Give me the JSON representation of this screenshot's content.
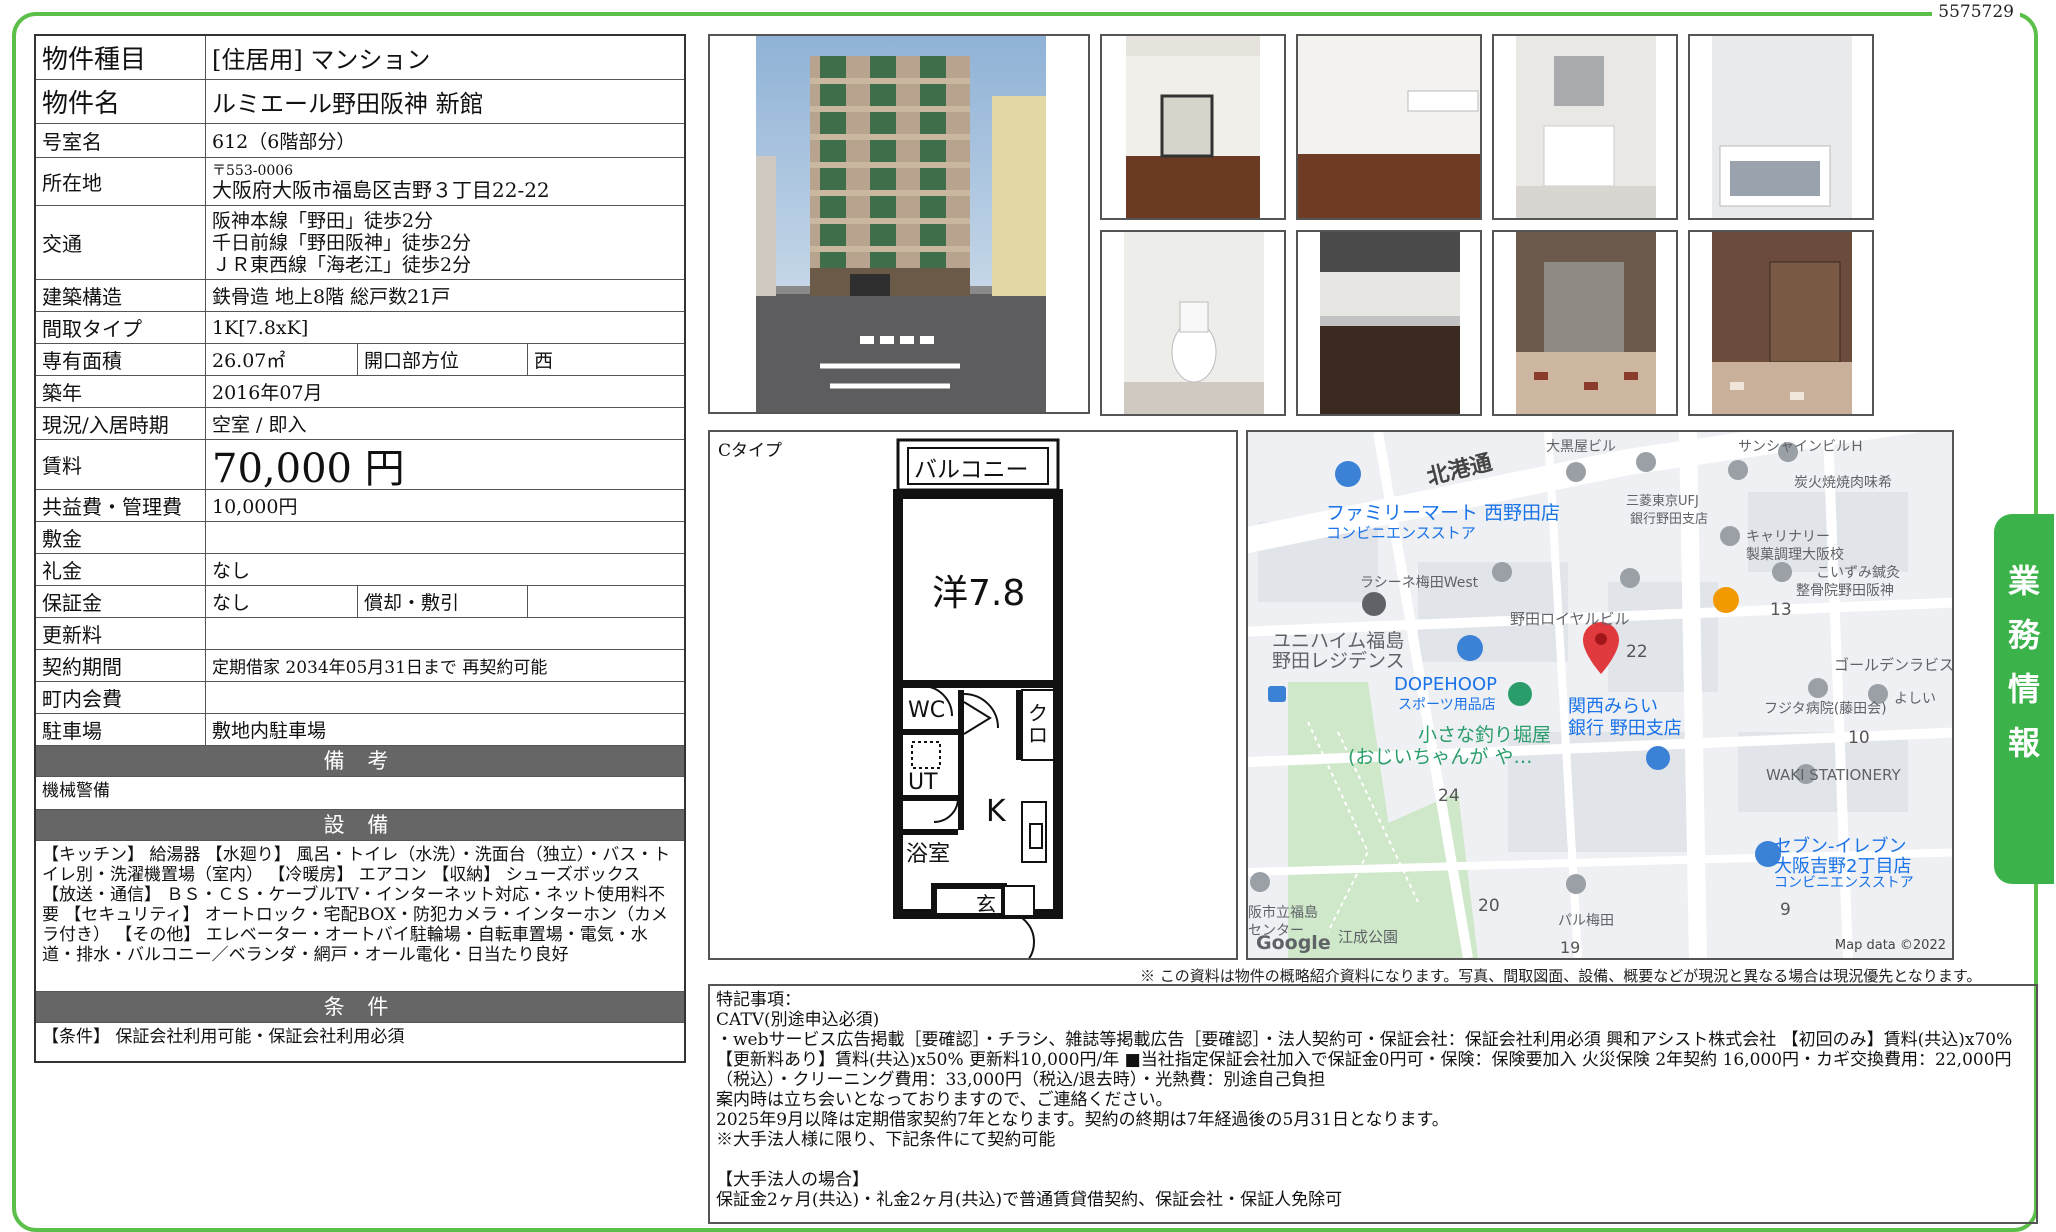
{
  "doc_id": "5575729",
  "info": {
    "type_label": "物件種目",
    "type_value": "[住居用] マンション",
    "name_label": "物件名",
    "name_value": "ルミエール野田阪神 新館",
    "room_label": "号室名",
    "room_value": "612（6階部分）",
    "addr_label": "所在地",
    "addr_zip": "〒553-0006",
    "addr_value": "大阪府大阪市福島区吉野３丁目22-22",
    "access_label": "交通",
    "access": [
      "阪神本線「野田」徒歩2分",
      "千日前線「野田阪神」徒歩2分",
      "ＪＲ東西線「海老江」徒歩2分"
    ],
    "struct_label": "建築構造",
    "struct_value": "鉄骨造 地上8階 総戸数21戸",
    "layout_label": "間取タイプ",
    "layout_value": "1K[7.8xK]",
    "area_label": "専有面積",
    "area_value": "26.07㎡",
    "direction_label": "開口部方位",
    "direction_value": "西",
    "built_label": "築年",
    "built_value": "2016年07月",
    "status_label": "現況/入居時期",
    "status_value": "空室 / 即入",
    "rent_label": "賃料",
    "rent_value": "70,000 円",
    "fee_label": "共益費・管理費",
    "fee_value": "10,000円",
    "deposit_label": "敷金",
    "deposit_value": "",
    "key_label": "礼金",
    "key_value": "なし",
    "guarantee_label": "保証金",
    "guarantee_value": "なし",
    "amort_label": "償却・敷引",
    "amort_value": "",
    "renew_label": "更新料",
    "renew_value": "",
    "contract_label": "契約期間",
    "contract_value": "定期借家 2034年05月31日まで 再契約可能",
    "town_label": "町内会費",
    "town_value": "",
    "parking_label": "駐車場",
    "parking_value": "敷地内駐車場"
  },
  "remarks": {
    "title": "備 考",
    "text": "機械警備"
  },
  "equipment": {
    "title": "設 備",
    "text": "【キッチン】 給湯器 【水廻り】 風呂・トイレ（水洗）・洗面台（独立）・バス・トイレ別・洗濯機置場（室内） 【冷暖房】 エアコン 【収納】 シューズボックス 【放送・通信】 ＢＳ・ＣＳ・ケーブルTV・インターネット対応・ネット使用料不要 【セキュリティ】 オートロック・宅配BOX・防犯カメラ・インターホン（カメラ付き） 【その他】 エレベーター・オートバイ駐輪場・自転車置場・電気・水道・排水・バルコニー／ベランダ・網戸・オール電化・日当たり良好"
  },
  "conditions": {
    "title": "条 件",
    "text": "【条件】 保証会社利用可能・保証会社利用必須"
  },
  "floorplan": {
    "type_label": "Cタイプ",
    "balcony": "バルコニー",
    "western_room": "洋7.8",
    "wc": "WC",
    "closet": "クロ",
    "ut": "UT",
    "kitchen": "K",
    "bath": "浴室",
    "entrance": "玄"
  },
  "map": {
    "streets": [
      "北港通"
    ],
    "places": [
      "ファミリーマート 西野田店",
      "コンビニエンスストア",
      "ラシーネ梅田West",
      "ユニハイム福島",
      "野田レジデンス",
      "DOPEHOOP",
      "スポーツ用品店",
      "小さな釣り堀屋",
      "(おじいちゃんが や…",
      "野田ロイヤルビル",
      "関西みらい",
      "銀行 野田支店",
      "大黒屋ビル",
      "三菱東京UFJ",
      "銀行野田支店",
      "サンシャインビルＨ",
      "炭火焼焼肉味希",
      "キャリナリー",
      "製菓調理大阪校",
      "こいずみ鍼灸",
      "整骨院野田阪神",
      "ゴールデンラビス",
      "フジタ病院(藤田会)",
      "よしい",
      "WAKI STATIONERY",
      "セブン-イレブン",
      "大阪吉野2丁目店",
      "コンビニエンスストア",
      "阪市立福島",
      "センター",
      "江成公園",
      "パル梅田"
    ],
    "numbers": [
      "22",
      "13",
      "10",
      "24",
      "20",
      "9",
      "19"
    ],
    "google": "Google",
    "credit": "Map data ©2022",
    "colors": {
      "pin": "#e03a3e",
      "roads": "#ffffff",
      "park": "#cfe8c9",
      "poi_blue": "#3b82d6",
      "poi_text": "#1a73e8"
    }
  },
  "disclaimer": "※ この資料は物件の概略紹介資料になります。写真、間取図面、設備、概要などが現況と異なる場合は現況優先となります。",
  "notes": {
    "lines": [
      "特記事項：",
      "CATV(別途申込必須)",
      "・webサービス広告掲載［要確認］・チラシ、雑誌等掲載広告［要確認］・法人契約可・保証会社：保証会社利用必須 興和アシスト株式会社 【初回のみ】賃料(共込)x70% 【更新料あり】賃料(共込)x50% 更新料10,000円/年 ■当社指定保証会社加入で保証金0円可・保険：保険要加入 火災保険 2年契約 16,000円・カギ交換費用：22,000円（税込）・クリーニング費用：33,000円（税込/退去時）・光熱費：別途自己負担",
      "案内時は立ち会いとなっておりますので、ご連絡ください。",
      "2025年9月以降は定期借家契約7年となります。契約の終期は7年経過後の5月31日となります。",
      "※大手法人様に限り、下記条件にて契約可能",
      "",
      "【大手法人の場合】",
      "保証金2ヶ月(共込)・礼金2ヶ月(共込)で普通賃貸借契約、保証会社・保証人免除可"
    ]
  },
  "sidetab": "業務情報"
}
